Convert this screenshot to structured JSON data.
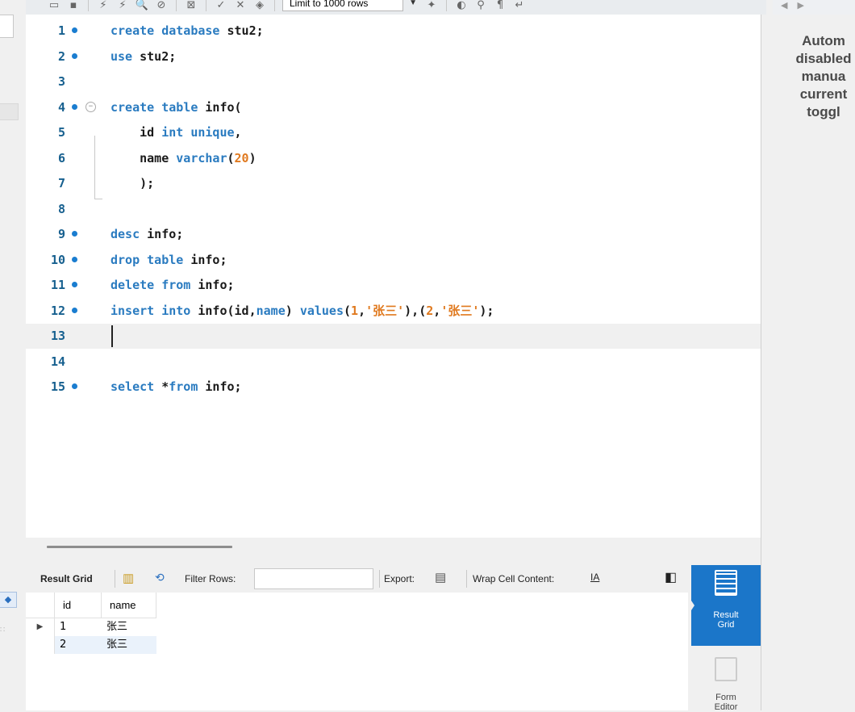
{
  "toolbar": {
    "limit_select_value": "Limit to 1000 rows"
  },
  "editor": {
    "lines": [
      {
        "num": "1",
        "marker": true,
        "tokens": [
          {
            "t": "create database ",
            "c": "kw"
          },
          {
            "t": "stu2;",
            "c": "id"
          }
        ]
      },
      {
        "num": "2",
        "marker": true,
        "tokens": [
          {
            "t": "use ",
            "c": "kw"
          },
          {
            "t": "stu2;",
            "c": "id"
          }
        ]
      },
      {
        "num": "3",
        "marker": false,
        "tokens": []
      },
      {
        "num": "4",
        "marker": true,
        "fold": true,
        "tokens": [
          {
            "t": "create table ",
            "c": "kw"
          },
          {
            "t": "info(",
            "c": "id"
          }
        ]
      },
      {
        "num": "5",
        "marker": false,
        "tokens": [
          {
            "t": "    id ",
            "c": "id"
          },
          {
            "t": "int unique",
            "c": "kw"
          },
          {
            "t": ",",
            "c": "id"
          }
        ]
      },
      {
        "num": "6",
        "marker": false,
        "tokens": [
          {
            "t": "    name ",
            "c": "id"
          },
          {
            "t": "varchar",
            "c": "kw"
          },
          {
            "t": "(",
            "c": "id"
          },
          {
            "t": "20",
            "c": "num"
          },
          {
            "t": ")",
            "c": "id"
          }
        ]
      },
      {
        "num": "7",
        "marker": false,
        "tokens": [
          {
            "t": "    );",
            "c": "id"
          }
        ]
      },
      {
        "num": "8",
        "marker": false,
        "tokens": []
      },
      {
        "num": "9",
        "marker": true,
        "tokens": [
          {
            "t": "desc ",
            "c": "kw"
          },
          {
            "t": "info;",
            "c": "id"
          }
        ]
      },
      {
        "num": "10",
        "marker": true,
        "tokens": [
          {
            "t": "drop table ",
            "c": "kw"
          },
          {
            "t": "info;",
            "c": "id"
          }
        ]
      },
      {
        "num": "11",
        "marker": true,
        "tokens": [
          {
            "t": "delete from ",
            "c": "kw"
          },
          {
            "t": "info;",
            "c": "id"
          }
        ]
      },
      {
        "num": "12",
        "marker": true,
        "tokens": [
          {
            "t": "insert into ",
            "c": "kw"
          },
          {
            "t": "info(id,",
            "c": "id"
          },
          {
            "t": "name",
            "c": "kw"
          },
          {
            "t": ") ",
            "c": "id"
          },
          {
            "t": "values",
            "c": "kw"
          },
          {
            "t": "(",
            "c": "id"
          },
          {
            "t": "1",
            "c": "num"
          },
          {
            "t": ",",
            "c": "id"
          },
          {
            "t": "'张三'",
            "c": "str"
          },
          {
            "t": "),(",
            "c": "id"
          },
          {
            "t": "2",
            "c": "num"
          },
          {
            "t": ",",
            "c": "id"
          },
          {
            "t": "'张三'",
            "c": "str"
          },
          {
            "t": ");",
            "c": "id"
          }
        ]
      },
      {
        "num": "13",
        "marker": false,
        "current": true,
        "tokens": []
      },
      {
        "num": "14",
        "marker": false,
        "tokens": []
      },
      {
        "num": "15",
        "marker": true,
        "tokens": [
          {
            "t": "select ",
            "c": "kw"
          },
          {
            "t": "*",
            "c": "id"
          },
          {
            "t": "from ",
            "c": "kw"
          },
          {
            "t": "info;",
            "c": "id"
          }
        ]
      }
    ]
  },
  "result_toolbar": {
    "result_grid_label": "Result Grid",
    "filter_rows_label": "Filter Rows:",
    "filter_value": "",
    "export_label": "Export:",
    "wrap_label": "Wrap Cell Content:"
  },
  "result_grid": {
    "columns": [
      "id",
      "name"
    ],
    "rows": [
      [
        "1",
        "张三"
      ],
      [
        "2",
        "张三"
      ]
    ]
  },
  "side_tabs": {
    "active_line1": "Result",
    "active_line2": "Grid",
    "inactive_line1": "Form",
    "inactive_line2": "Editor"
  },
  "context_help": {
    "lines": [
      "Autom",
      "disabled",
      "manua",
      "current",
      "toggl"
    ]
  },
  "colors": {
    "keyword": "#2a7bc0",
    "number": "#e07a20",
    "active_tab": "#1b76c9"
  }
}
